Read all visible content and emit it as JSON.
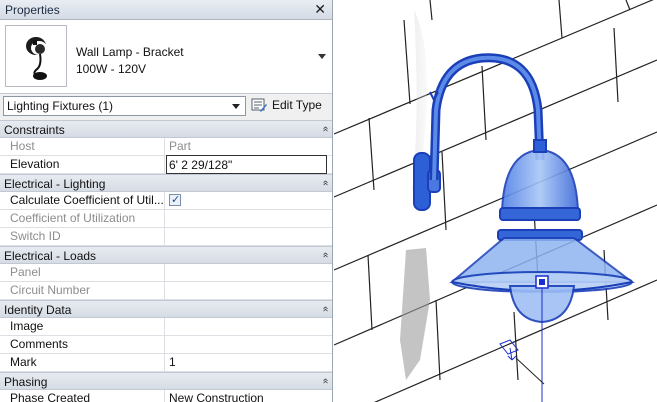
{
  "panel": {
    "title": "Properties",
    "close_glyph": "✕",
    "type_selector": {
      "name": "Wall Lamp - Bracket",
      "subtitle": "100W - 120V",
      "thumbnail_icon": "wall-lamp-thumbnail"
    },
    "instance_filter": {
      "value": "Lighting Fixtures (1)",
      "edit_type_label": "Edit Type"
    },
    "groups": [
      {
        "label": "Constraints",
        "rows": [
          {
            "label": "Host",
            "value": "Part",
            "dim": true
          },
          {
            "label": "Elevation",
            "value": "6'  2 29/128\"",
            "dim": false,
            "editing": true
          }
        ]
      },
      {
        "label": "Electrical - Lighting",
        "rows": [
          {
            "label": "Calculate Coefficient of Util...",
            "value": "",
            "checkbox": true,
            "checked": true
          },
          {
            "label": "Coefficient of Utilization",
            "value": "",
            "dim": true
          },
          {
            "label": "Switch ID",
            "value": "",
            "dim": true
          }
        ]
      },
      {
        "label": "Electrical - Loads",
        "rows": [
          {
            "label": "Panel",
            "value": "",
            "dim": true
          },
          {
            "label": "Circuit Number",
            "value": "",
            "dim": true
          }
        ]
      },
      {
        "label": "Identity Data",
        "rows": [
          {
            "label": "Image",
            "value": ""
          },
          {
            "label": "Comments",
            "value": ""
          },
          {
            "label": "Mark",
            "value": "1"
          }
        ]
      },
      {
        "label": "Phasing",
        "rows": [
          {
            "label": "Phase Created",
            "value": "New Construction"
          }
        ]
      }
    ],
    "collapse_glyph": "«"
  },
  "colors": {
    "lamp_blue": "#2d5fd6",
    "lamp_light": "#8fb4f2",
    "selection_line": "#1a2fd0"
  }
}
